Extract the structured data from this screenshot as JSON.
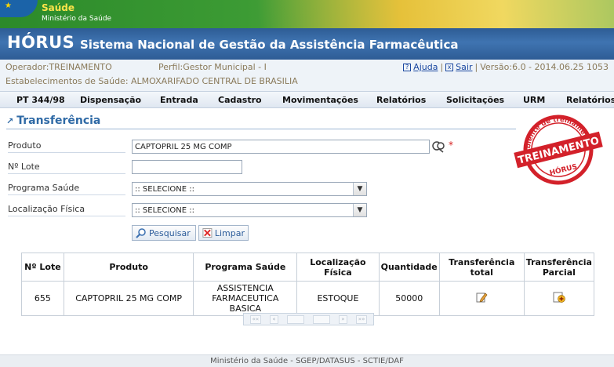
{
  "banner": {
    "brand": "Saúde",
    "ministry": "Ministério da Saúde"
  },
  "header": {
    "app_name": "HÓRUS",
    "app_subtitle": "Sistema Nacional de Gestão da Assistência Farmacêutica"
  },
  "info": {
    "operador": "Operador:TREINAMENTO",
    "perfil": "Perfil:Gestor Municipal - I",
    "estabelecimento": "Estabelecimentos de Saúde: ALMOXARIFADO CENTRAL DE BRASILIA",
    "help_label": "Ajuda",
    "exit_label": "Sair",
    "version": "Versão:6.0 - 2014.06.25 1053",
    "separator": "|"
  },
  "menu": {
    "items": [
      "PT 344/98",
      "Dispensação",
      "Entrada",
      "Cadastro",
      "Movimentações",
      "Relatórios",
      "Solicitações",
      "URM",
      "Relatórios"
    ]
  },
  "page": {
    "title": "Transferência"
  },
  "stamp": {
    "top_text": "Ambiente de treinamento",
    "main_text": "TREINAMENTO",
    "bottom_text": "HÓRUS"
  },
  "form": {
    "produto_label": "Produto",
    "produto_value": "CAPTOPRIL 25 MG COMP",
    "required_mark": "*",
    "lote_label": "Nº Lote",
    "lote_value": "",
    "programa_label": "Programa Saúde",
    "programa_value": ":: SELECIONE ::",
    "localizacao_label": "Localização Física",
    "localizacao_value": ":: SELECIONE ::",
    "search_label": "Pesquisar",
    "clear_label": "Limpar"
  },
  "table": {
    "headers": [
      "Nº Lote",
      "Produto",
      "Programa Saúde",
      "Localização Física",
      "Quantidade",
      "Transferência total",
      "Transferência Parcial"
    ],
    "rows": [
      {
        "lote": "655",
        "produto": "CAPTOPRIL 25 MG COMP",
        "programa": "ASSISTENCIA FARMACEUTICA BASICA",
        "localizacao": "ESTOQUE",
        "quantidade": "50000"
      }
    ]
  },
  "pager": {
    "first": "««",
    "prev": "«",
    "next": "»",
    "last": "»»"
  },
  "footer": {
    "text": "Ministério da Saúde - SGEP/DATASUS - SCTIE/DAF"
  },
  "colors": {
    "brand_blue": "#2f6aa6",
    "title_bar": "#3f74b1",
    "stamp_red": "#d3212a"
  }
}
